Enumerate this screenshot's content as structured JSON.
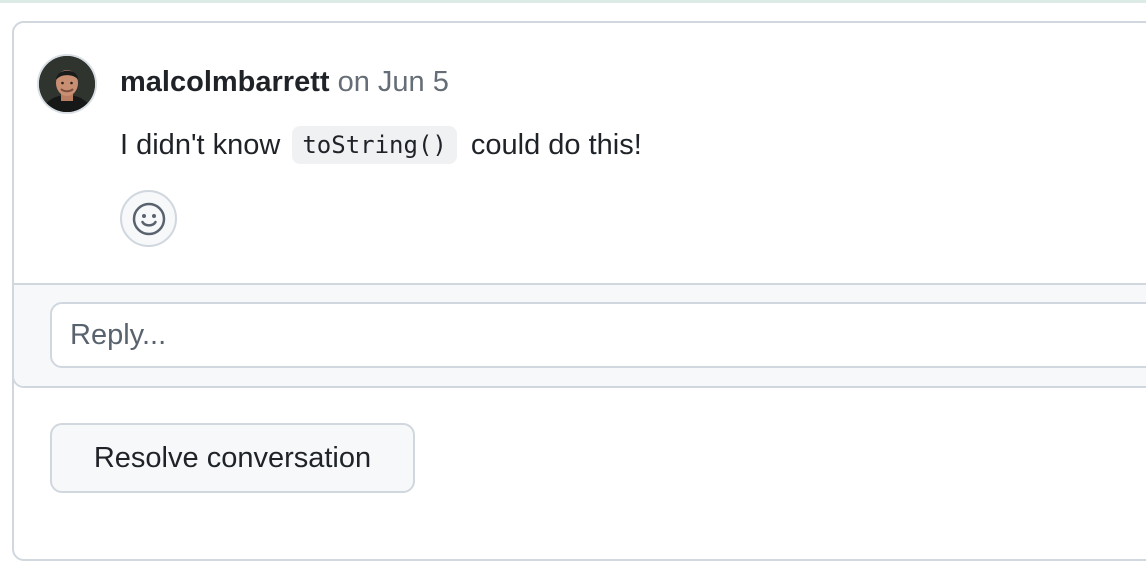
{
  "comment": {
    "author": "malcolmbarrett",
    "date_prefix": "on",
    "date": "Jun 5",
    "text_before": "I didn't know",
    "code": "toString()",
    "text_after": "could do this!",
    "avatar_icon": "user-avatar-photo"
  },
  "reactions": {
    "add_icon": "smiley-icon"
  },
  "reply": {
    "placeholder": "Reply..."
  },
  "actions": {
    "resolve_label": "Resolve conversation"
  },
  "colors": {
    "border": "#d0d7de",
    "muted_text": "#656d76",
    "text": "#1f2328",
    "subtle_bg": "#f6f8fa",
    "code_bg": "#eff1f3"
  }
}
